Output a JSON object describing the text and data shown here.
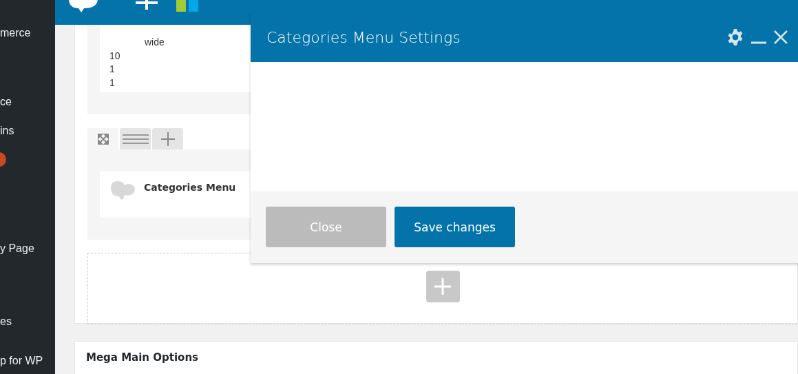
{
  "sidebar": {
    "items": [
      {
        "label": "merce"
      },
      {
        "label": "ce"
      },
      {
        "label": "ins",
        "badge": true
      },
      {
        "label": "y Page"
      },
      {
        "label": "es"
      },
      {
        "label": "p for WP"
      }
    ]
  },
  "top_bar": {
    "icons": [
      {
        "kind": "bubble"
      },
      {
        "kind": "plus"
      },
      {
        "kind": "bars"
      }
    ]
  },
  "builder": {
    "nested_values": [
      "wide"
    ],
    "values": [
      "10",
      "1",
      "1"
    ],
    "tabs": [
      {
        "kind": "expand",
        "selected": true
      },
      {
        "kind": "lines",
        "selected": false
      },
      {
        "kind": "plus",
        "selected": false
      }
    ],
    "widget": {
      "title": "Categories Menu"
    }
  },
  "next_panel": {
    "title": "Mega Main Options"
  },
  "modal": {
    "title": "Categories Menu Settings",
    "buttons": [
      {
        "label": "Close",
        "kind": "secondary"
      },
      {
        "label": "Save changes",
        "kind": "primary"
      }
    ]
  }
}
